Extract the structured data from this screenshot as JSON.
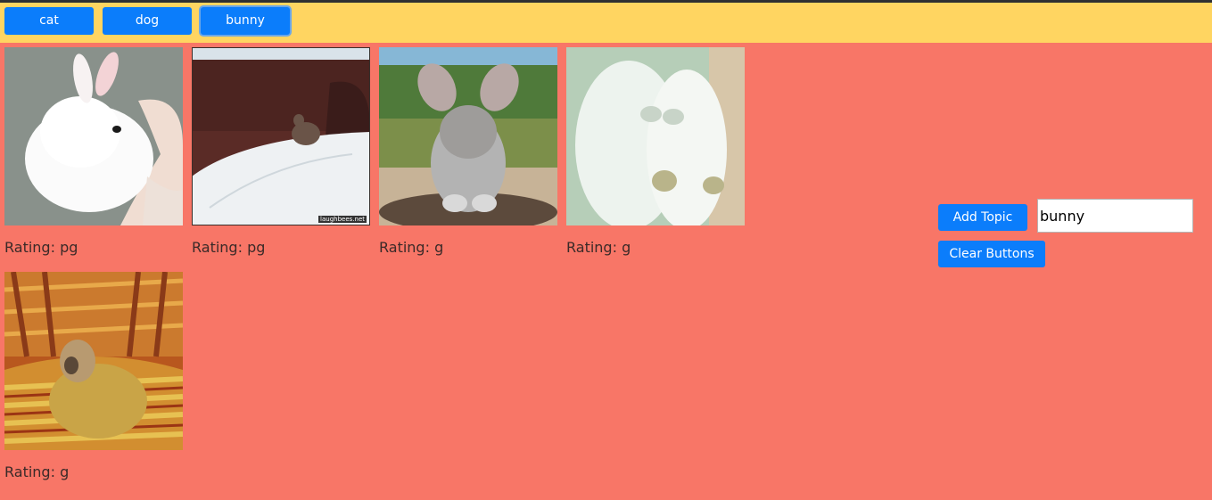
{
  "topic_buttons": [
    "cat",
    "dog",
    "bunny"
  ],
  "active_topic": "bunny",
  "gifs": [
    {
      "rating_label": "Rating: pg"
    },
    {
      "rating_label": "Rating: pg",
      "watermark": "laughbees.net"
    },
    {
      "rating_label": "Rating: g"
    },
    {
      "rating_label": "Rating: g"
    },
    {
      "rating_label": "Rating: g"
    }
  ],
  "controls": {
    "add_topic_label": "Add Topic",
    "clear_buttons_label": "Clear Buttons",
    "topic_input_value": "bunny"
  },
  "colors": {
    "page_background": "#f87667",
    "topbar_background": "#ffd561",
    "button_blue": "#0b7dfb"
  }
}
